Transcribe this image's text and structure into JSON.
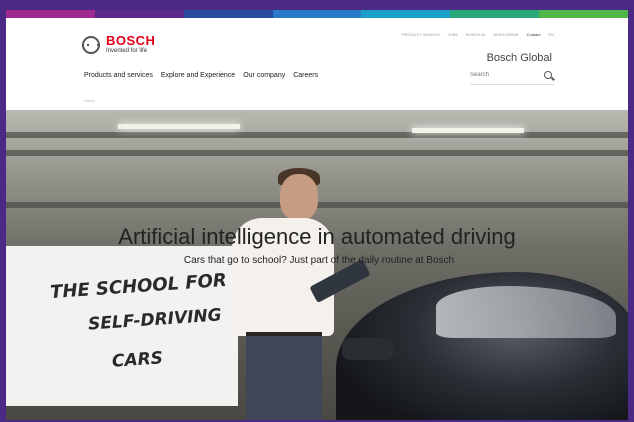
{
  "brand": {
    "name": "BOSCH",
    "tagline": "Invented for life",
    "red": "#e2001a"
  },
  "rainbow": [
    "#9e2a8f",
    "#5a2b8a",
    "#2a4aa0",
    "#2a78c8",
    "#1aa0c8",
    "#28a878",
    "#50b848"
  ],
  "utility_links": [
    {
      "label": "PRODUCT SEARCH"
    },
    {
      "label": "JOBS"
    },
    {
      "label": "BOSCH IN"
    },
    {
      "label": "WORLDWIDE"
    },
    {
      "label": "Contact"
    },
    {
      "label": "EN"
    }
  ],
  "site_title": "Bosch Global",
  "nav": [
    "Products and services",
    "Explore and Experience",
    "Our company",
    "Careers"
  ],
  "search": {
    "placeholder": "Search"
  },
  "breadcrumb": "Home",
  "hero": {
    "title": "Artificial intelligence in automated driving",
    "subtitle": "Cars that go to school? Just part of the daily routine at Bosch",
    "whiteboard_lines": [
      "THE SCHOOL FOR",
      "SELF-DRIVING",
      "CARS"
    ]
  }
}
